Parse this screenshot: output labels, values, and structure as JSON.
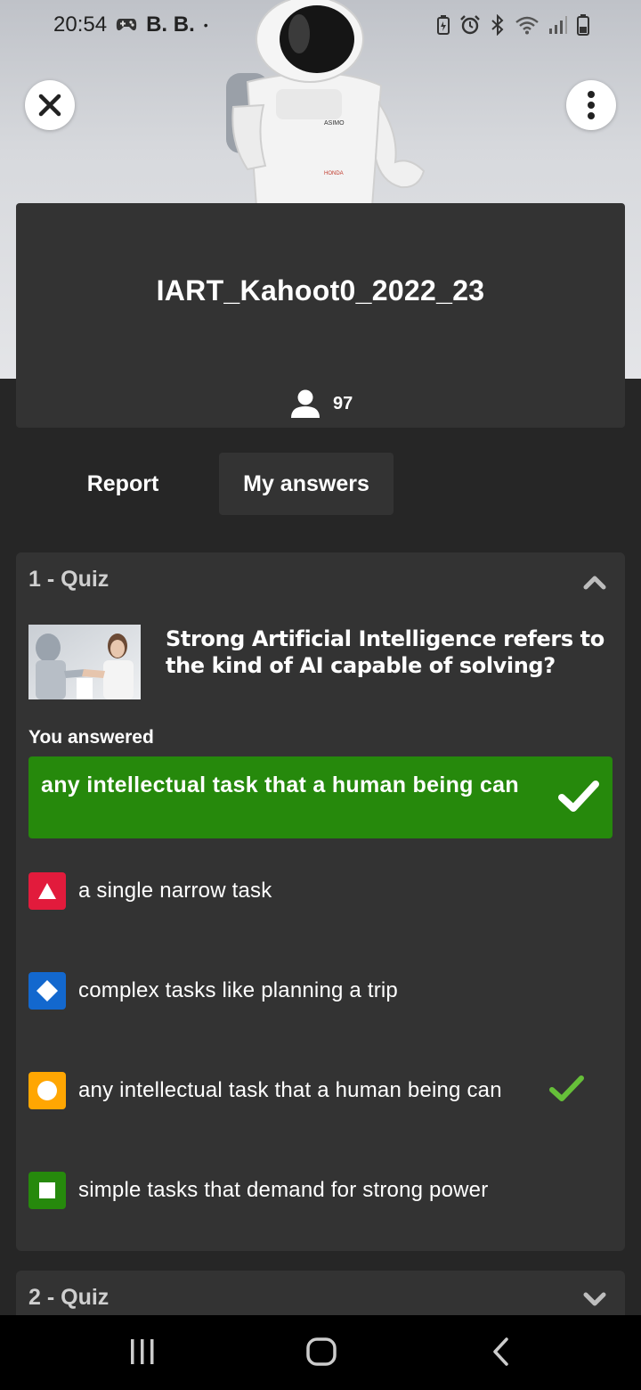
{
  "status_bar": {
    "time": "20:54",
    "carrier": "B. B.",
    "dot": "•"
  },
  "header": {
    "title": "IART_Kahoot0_2022_23",
    "players_count": "97"
  },
  "tabs": [
    {
      "label": "Report",
      "active": false
    },
    {
      "label": "My answers",
      "active": true
    }
  ],
  "questions": [
    {
      "header": "1 - Quiz",
      "expanded": true,
      "text": "Strong Artificial Intelligence refers to the kind of AI capable of solving?",
      "you_answered_label": "You answered",
      "your_answer": "any intellectual task that a human being can",
      "your_answer_correct": true,
      "options": [
        {
          "shape": "triangle",
          "color": "#e21b3c",
          "label": "a single narrow task",
          "correct": false
        },
        {
          "shape": "diamond",
          "color": "#1368ce",
          "label": "complex tasks like planning a trip",
          "correct": false
        },
        {
          "shape": "circle",
          "color": "#ffa602",
          "label": "any intellectual task that a human being can",
          "correct": true
        },
        {
          "shape": "square",
          "color": "#26890c",
          "label": "simple tasks that demand for strong power",
          "correct": false
        }
      ]
    },
    {
      "header": "2 - Quiz",
      "expanded": false
    }
  ],
  "colors": {
    "background": "#262626",
    "card": "#333333",
    "correct_green": "#26890c",
    "check_green": "#66bf39"
  }
}
